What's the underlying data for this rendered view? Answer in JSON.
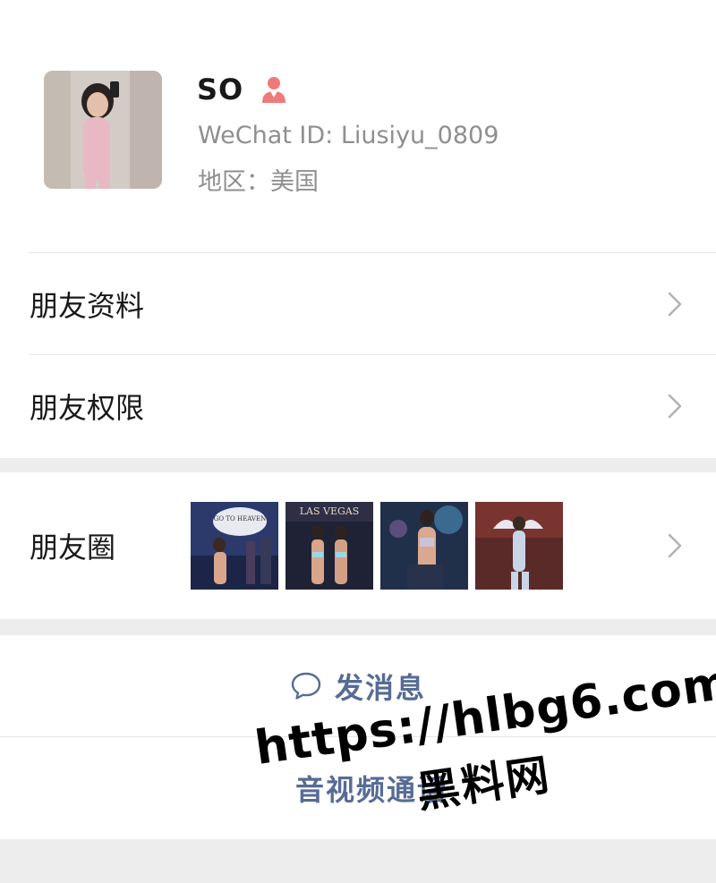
{
  "profile": {
    "name": "SO",
    "gender_icon": "female-gender-icon",
    "wechat_id": "WeChat ID: Liusiyu_0809",
    "region": "地区：美国",
    "avatar_icon": "profile-photo"
  },
  "menu": {
    "items": [
      {
        "label": "朋友资料",
        "icon": "chevron-right-icon"
      },
      {
        "label": "朋友权限",
        "icon": "chevron-right-icon"
      }
    ]
  },
  "moments": {
    "label": "朋友圈",
    "thumbnails": [
      {
        "caption": "GO TO HEAVEN"
      },
      {
        "caption": "LAS VEGAS"
      },
      {
        "caption": ""
      },
      {
        "caption": ""
      }
    ]
  },
  "actions": {
    "send_message": "发消息",
    "video_call": "音视频通话"
  },
  "watermark": {
    "url": "https://hlbg6.com",
    "text": "黑料网"
  },
  "colors": {
    "link": "#576b95",
    "background": "#ededed",
    "secondary_text": "#8f8f8f",
    "gender_icon": "#f07a7a"
  }
}
